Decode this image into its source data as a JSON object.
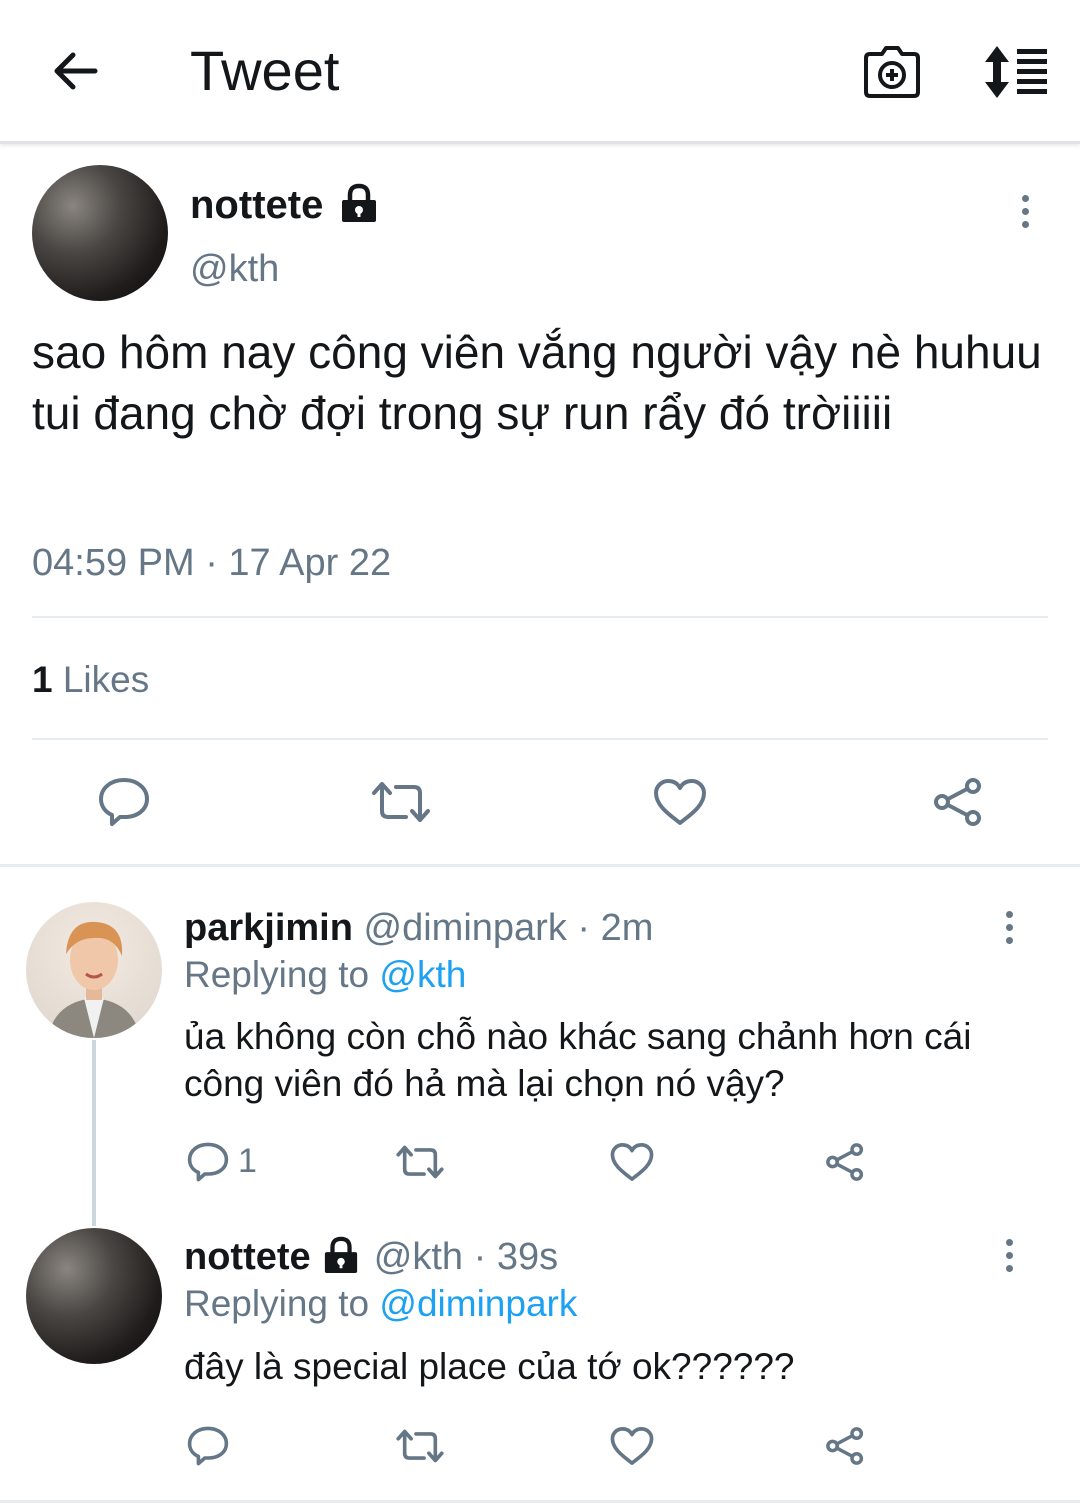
{
  "header": {
    "title": "Tweet",
    "back_icon": "arrow-left-icon",
    "camera_icon": "camera-add-icon",
    "sort_icon": "sort-list-icon"
  },
  "colors": {
    "text": "#14171a",
    "muted": "#657786",
    "link": "#1da1f2",
    "divider": "#e6ecf0"
  },
  "tweet": {
    "author_name": "nottete",
    "author_handle": "@kth",
    "text": "sao hôm nay công viên vắng người vậy nè huhuu tui đang chờ đợi trong sự run rẩy đó trờiiiii",
    "timestamp": "04:59 PM · 17 Apr 22",
    "likes_count": "1",
    "likes_label": "Likes",
    "actions": [
      "reply-icon",
      "retweet-icon",
      "like-icon",
      "share-icon"
    ]
  },
  "replies": [
    {
      "author_name": "parkjimin",
      "meta": "@diminpark · 2m",
      "replying_prefix": "Replying to ",
      "replying_to": "@kth",
      "text": "ủa không còn chỗ nào khác sang chảnh hơn cái công viên đó hả mà lại chọn nó vậy?",
      "reply_count": "1"
    },
    {
      "author_name": "nottete",
      "meta": "@kth · 39s",
      "replying_prefix": "Replying to ",
      "replying_to": "@diminpark",
      "text": "đây là special place của tớ ok??????",
      "reply_count": ""
    }
  ]
}
